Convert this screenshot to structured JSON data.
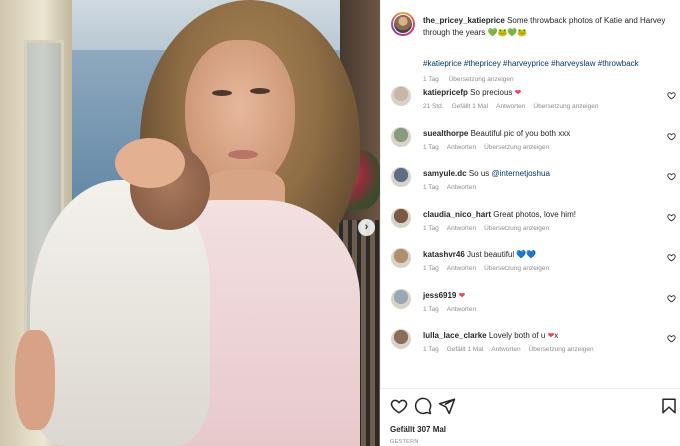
{
  "post": {
    "author": "the_pricey_katieprice",
    "caption": "Some throwback photos of Katie and Harvey through the years",
    "caption_emojis": "💚🐸💚🐸",
    "hashtags": "#katieprice #thepricey #harveyprice #harveyslaw #throwback",
    "time": "1 Tag",
    "translate": "Übersetzung anzeigen",
    "likes": "Gefällt 307 Mal",
    "date": "GESTERN"
  },
  "comments": [
    {
      "user": "katiepricefp",
      "text": "So precious",
      "emoji": "❤",
      "emoji_color": "#ed4956",
      "time": "21 Std.",
      "likes": "Gefällt 1 Mal",
      "reply": "Antworten",
      "translate": "Übersetzung anzeigen",
      "avatar_color": "#c9b7a6"
    },
    {
      "user": "suealthorpe",
      "text": "Beautiful pic of you both xxx",
      "emoji": "",
      "emoji_color": "",
      "time": "1 Tag",
      "likes": "",
      "reply": "Antworten",
      "translate": "Übersetzung anzeigen",
      "avatar_color": "#8a9a7e"
    },
    {
      "user": "samyule.dc",
      "text": "So us",
      "mention": "@internetjoshua",
      "emoji": "",
      "emoji_color": "",
      "time": "1 Tag",
      "likes": "",
      "reply": "Antworten",
      "translate": "",
      "avatar_color": "#5c6e83"
    },
    {
      "user": "claudia_nico_hart",
      "text": "Great photos, love him!",
      "emoji": "",
      "emoji_color": "",
      "time": "1 Tag",
      "likes": "",
      "reply": "Antworten",
      "translate": "Übersetzung anzeigen",
      "avatar_color": "#7a5a44"
    },
    {
      "user": "katashvr46",
      "text": "Just beautiful",
      "emoji": "💙💙",
      "emoji_color": "#2f7dd6",
      "time": "1 Tag",
      "likes": "",
      "reply": "Antworten",
      "translate": "Übersetzung anzeigen",
      "avatar_color": "#b08f6e"
    },
    {
      "user": "jess6919",
      "text": "",
      "emoji": "❤",
      "emoji_color": "#ed4956",
      "time": "1 Tag",
      "likes": "",
      "reply": "Antworten",
      "translate": "",
      "avatar_color": "#9aa7b5"
    },
    {
      "user": "lulla_lace_clarke",
      "text": "Lovely both of u",
      "emoji": "❤",
      "emoji_suffix": "x",
      "emoji_color": "#ed4956",
      "time": "1 Tag",
      "likes": "Gefällt 1 Mal",
      "reply": "Antworten",
      "translate": "Übersetzung anzeigen",
      "avatar_color": "#8c6d5c"
    }
  ],
  "icons": {
    "like": "heart-icon",
    "comment": "comment-icon",
    "share": "share-icon",
    "save": "bookmark-icon",
    "next": "chevron-right-icon"
  }
}
